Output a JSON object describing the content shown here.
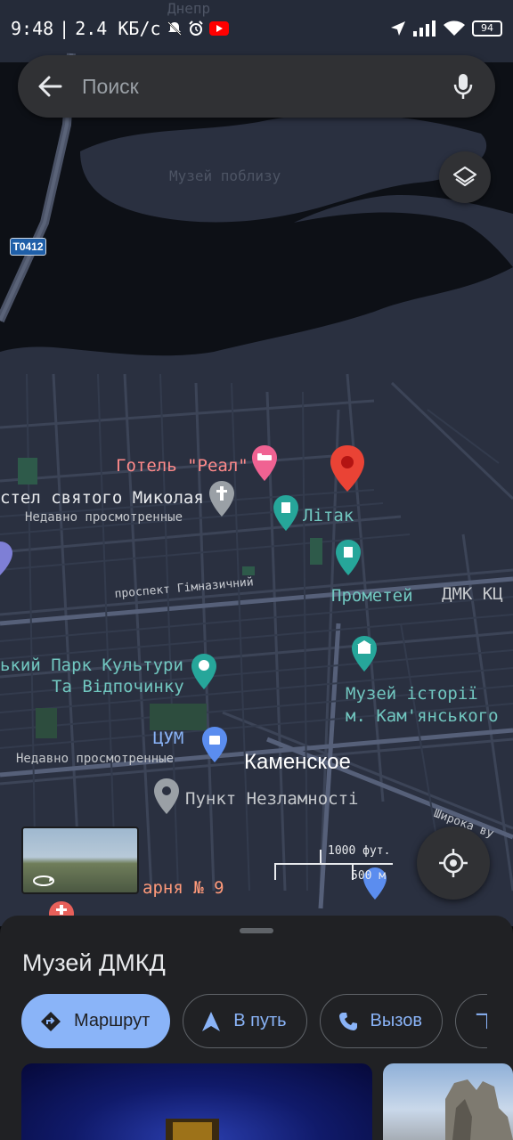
{
  "status_bar": {
    "time": "9:48",
    "separator": "|",
    "network_speed": "2.4 КБ/с",
    "battery": "94",
    "icons": [
      "mute-icon",
      "alarm-icon",
      "youtube-icon",
      "location-arrow-icon",
      "signal-icon",
      "wifi-icon",
      "battery-icon"
    ]
  },
  "search": {
    "placeholder": "Поиск"
  },
  "map": {
    "road_shield": "Т0412",
    "river_label": "Днепр",
    "labels": {
      "hotel": "Готель \"Реал\"",
      "church": "стел святого Миколая",
      "church_sub": "Недавно просмотренные",
      "litak": "Літак",
      "prometei": "Прометей",
      "dmk": "ДМК КЦ",
      "avenue": "проспект Гімназичний",
      "park_line1": "ький Парк Культури",
      "park_line2": "Та Відпочинку",
      "museum_line1": "Музей історії",
      "museum_line2": "м. Кам'янського",
      "tsum": "ЦУМ",
      "tsum_sub": "Недавно просмотренные",
      "city": "Каменское",
      "punkt": "Пункт Незламності",
      "shyroka": "Широка ву",
      "pharmacy": "арня № 9",
      "faint_museum": "Музей поблизу"
    },
    "scale": {
      "imperial": "1000 фут.",
      "metric": "500 м"
    }
  },
  "place_sheet": {
    "title": "Музей ДМКД",
    "actions": [
      {
        "label": "Маршрут",
        "icon": "directions-icon"
      },
      {
        "label": "В путь",
        "icon": "navigation-icon"
      },
      {
        "label": "Вызов",
        "icon": "phone-icon"
      }
    ]
  },
  "colors": {
    "accent": "#8ab4f8",
    "sheet_bg": "#202124",
    "teal": "#71c7c0",
    "red_pin": "#ea4335"
  }
}
